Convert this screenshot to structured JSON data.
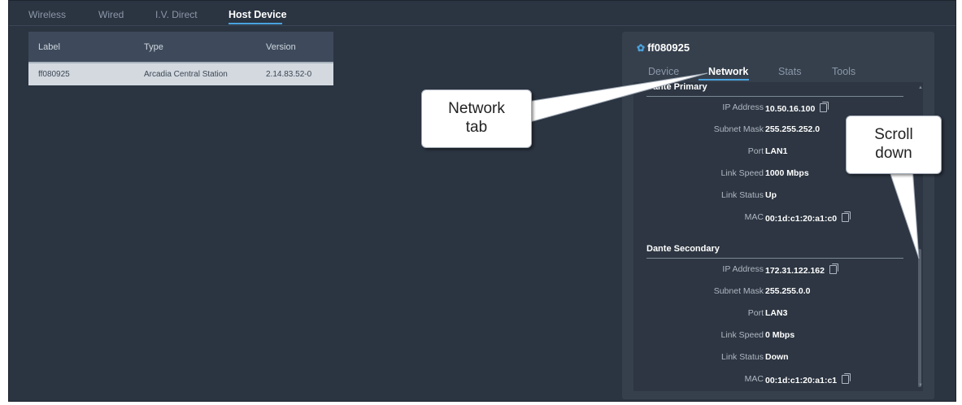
{
  "tabs": [
    {
      "label": "Wireless"
    },
    {
      "label": "Wired"
    },
    {
      "label": "I.V. Direct"
    },
    {
      "label": "Host Device"
    }
  ],
  "table": {
    "headers": [
      "Label",
      "Type",
      "Version"
    ],
    "rows": [
      [
        "ff080925",
        "Arcadia Central Station",
        "2.14.83.52-0"
      ]
    ]
  },
  "panel": {
    "title": "ff080925",
    "tabs": [
      "Device",
      "Network",
      "Stats",
      "Tools"
    ],
    "active_tab": "Network",
    "primary": {
      "title": "Dante Primary",
      "fields": [
        {
          "label": "IP Address",
          "value": "10.50.16.100"
        },
        {
          "label": "Subnet Mask",
          "value": "255.255.252.0"
        },
        {
          "label": "Port",
          "value": "LAN1"
        },
        {
          "label": "Link Speed",
          "value": "1000 Mbps"
        },
        {
          "label": "Link Status",
          "value": "Up"
        },
        {
          "label": "MAC",
          "value": "00:1d:c1:20:a1:c0"
        }
      ]
    },
    "secondary": {
      "title": "Dante Secondary",
      "fields": [
        {
          "label": "IP Address",
          "value": "172.31.122.162"
        },
        {
          "label": "Subnet Mask",
          "value": "255.255.0.0"
        },
        {
          "label": "Port",
          "value": "LAN3"
        },
        {
          "label": "Link Speed",
          "value": "0 Mbps"
        },
        {
          "label": "Link Status",
          "value": "Down"
        },
        {
          "label": "MAC",
          "value": "00:1d:c1:20:a1:c1"
        }
      ]
    }
  },
  "callouts": {
    "network_tab": {
      "line1": "Network",
      "line2": "tab"
    },
    "scroll_down": {
      "line1": "Scroll",
      "line2": "down"
    }
  },
  "colors": {
    "accent": "#4aa3df",
    "background": "#2b3441",
    "panel": "#36404d"
  }
}
